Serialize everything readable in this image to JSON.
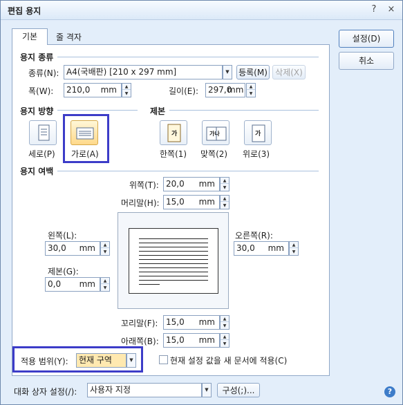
{
  "window": {
    "title": "편집 용지",
    "help_glyph": "?",
    "close_glyph": "×"
  },
  "tabs": [
    {
      "label": "기본"
    },
    {
      "label": "줄 격자"
    }
  ],
  "buttons": {
    "ok": "설정(D)",
    "cancel": "취소"
  },
  "paper_type": {
    "group_title": "용지 종류",
    "kind_label": "종류(N):",
    "kind_value": "A4(국배판) [210 x 297 mm]",
    "register_label": "등록(M)",
    "delete_label": "삭제(X)",
    "width_label": "폭(W):",
    "width_value": "210,0",
    "width_unit": "mm",
    "height_label": "길이(E):",
    "height_value": "297,0",
    "height_unit": "mm"
  },
  "orientation": {
    "group_title": "용지 방향",
    "portrait_label": "세로(P)",
    "landscape_label": "가로(A)",
    "selected": "landscape"
  },
  "binding": {
    "group_title": "제본",
    "single_label": "한쪽(1)",
    "facing_label": "맞쪽(2)",
    "top_label": "위로(3)",
    "icon_text": "가",
    "facing_icon_text": "가나"
  },
  "margins": {
    "group_title": "용지 여백",
    "top_label": "위쪽(T):",
    "top_value": "20,0",
    "header_label": "머리말(H):",
    "header_value": "15,0",
    "left_label": "왼쪽(L):",
    "left_value": "30,0",
    "right_label": "오른쪽(R):",
    "right_value": "30,0",
    "gutter_label": "제본(G):",
    "gutter_value": "0,0",
    "footer_label": "꼬리말(F):",
    "footer_value": "15,0",
    "bottom_label": "아래쪽(B):",
    "bottom_value": "15,0",
    "unit": "mm"
  },
  "apply": {
    "range_label": "적용 범위(Y):",
    "range_value": "현재 구역",
    "new_doc_label": "현재 설정 값을 새 문서에 적용(C)",
    "new_doc_checked": false
  },
  "footer": {
    "dialog_setting_label": "대화 상자 설정(/):",
    "dialog_setting_value": "사용자 지정",
    "config_button": "구성(;)..."
  },
  "colors": {
    "highlight": "#3c3cc8",
    "dialog_bg": "#e3eefa"
  }
}
